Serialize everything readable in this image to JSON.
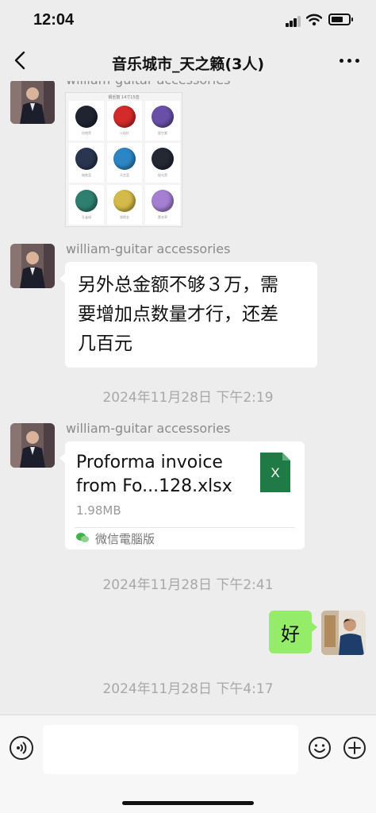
{
  "status_bar": {
    "time": "12:04",
    "battery_level": 0.7
  },
  "header": {
    "title": "音乐城市_天之籁(3人)"
  },
  "messages": [
    {
      "type": "image",
      "sender": "william-guitar accessories",
      "image_label": "钢舌鼓 14寸15音",
      "drums": [
        {
          "color": "#1f2430",
          "caption": "炫夜黑"
        },
        {
          "color": "#d32a2a",
          "caption": "火焰红"
        },
        {
          "color": "#6a4fa8",
          "caption": "星空紫"
        },
        {
          "color": "#2a3550",
          "caption": "暗夜蓝"
        },
        {
          "color": "#2d86c4",
          "caption": "天空蓝"
        },
        {
          "color": "#232833",
          "caption": "极光黑"
        },
        {
          "color": "#2f7f70",
          "caption": "孔雀绿"
        },
        {
          "color": "#d4ba4a",
          "caption": "香槟金"
        },
        {
          "color": "#a57fd2",
          "caption": "薰衣草"
        }
      ]
    },
    {
      "type": "text",
      "sender": "william-guitar accessories",
      "lines": [
        "另外总金额不够３万，需",
        "要增加点数量才行，还差",
        "几百元"
      ]
    },
    {
      "type": "timestamp",
      "text": "2024年11月28日 下午2:19"
    },
    {
      "type": "file",
      "sender": "william-guitar accessories",
      "title_lines": [
        "Proforma invoice",
        "from Fo...128.xlsx"
      ],
      "size": "1.98MB",
      "source": "微信電腦版",
      "file_icon_letter": "X"
    },
    {
      "type": "timestamp",
      "text": "2024年11月28日 下午2:41"
    },
    {
      "type": "text_self",
      "text": "好"
    },
    {
      "type": "timestamp",
      "text": "2024年11月28日 下午4:17"
    }
  ],
  "input": {
    "value": "",
    "placeholder": ""
  },
  "colors": {
    "background": "#ededed",
    "self_bubble": "#95ec69",
    "xlsx_green": "#1f7a45"
  }
}
